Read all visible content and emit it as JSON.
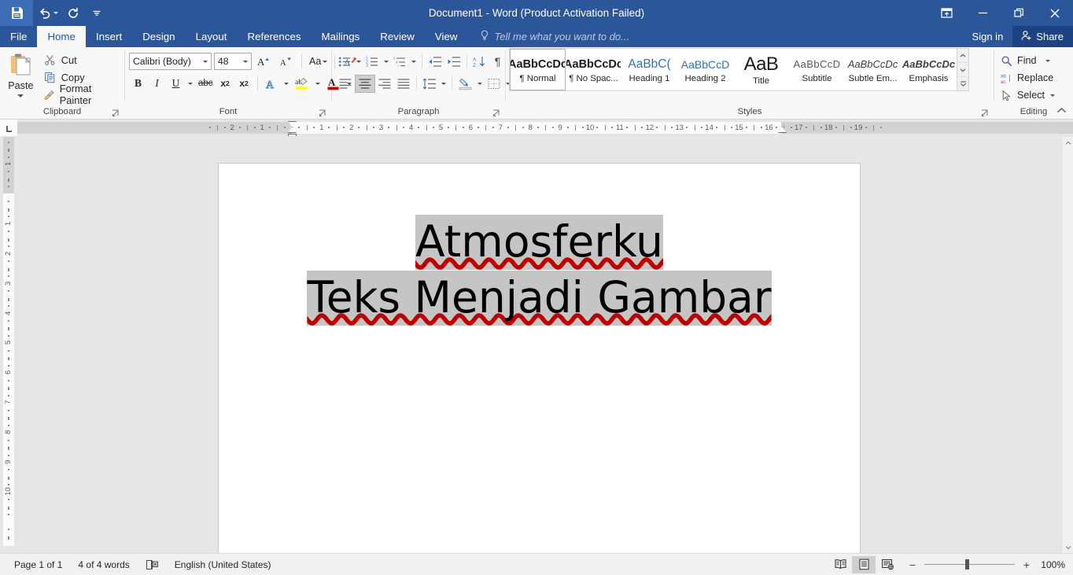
{
  "window": {
    "title": "Document1 - Word (Product Activation Failed)",
    "controls": {
      "ribbon_display_options": "ribbon-display-options",
      "minimize": "minimize",
      "restore": "restore",
      "close": "close"
    }
  },
  "quick_access": {
    "save": "Save",
    "undo": "Undo",
    "redo": "Redo",
    "customize": "Customize Quick Access Toolbar"
  },
  "tabs": [
    {
      "label": "File",
      "active": false
    },
    {
      "label": "Home",
      "active": true
    },
    {
      "label": "Insert",
      "active": false
    },
    {
      "label": "Design",
      "active": false
    },
    {
      "label": "Layout",
      "active": false
    },
    {
      "label": "References",
      "active": false
    },
    {
      "label": "Mailings",
      "active": false
    },
    {
      "label": "Review",
      "active": false
    },
    {
      "label": "View",
      "active": false
    }
  ],
  "tell_me": {
    "placeholder": "Tell me what you want to do..."
  },
  "account": {
    "sign_in": "Sign in",
    "share": "Share"
  },
  "ribbon": {
    "clipboard": {
      "group_label": "Clipboard",
      "paste": "Paste",
      "cut": "Cut",
      "copy": "Copy",
      "format_painter": "Format Painter"
    },
    "font": {
      "group_label": "Font",
      "font_name": "Calibri (Body)",
      "font_size": "48",
      "grow_font": "A",
      "shrink_font": "A",
      "change_case": "Aa",
      "clear_formatting": "Clear All Formatting",
      "bold": "B",
      "italic": "I",
      "underline": "U",
      "strikethrough": "abc",
      "subscript": "x",
      "subscript_sup": "2",
      "superscript": "x",
      "superscript_sup": "2",
      "text_effects": "A",
      "highlight": "ab",
      "font_color": "A"
    },
    "paragraph": {
      "group_label": "Paragraph",
      "bullets": "Bullets",
      "numbering": "Numbering",
      "multilevel": "Multilevel List",
      "decrease_indent": "Decrease Indent",
      "increase_indent": "Increase Indent",
      "sort": "Sort",
      "show_marks": "¶",
      "align_left": "Align Left",
      "align_center": "Center",
      "align_right": "Align Right",
      "justify": "Justify",
      "line_spacing": "Line and Paragraph Spacing",
      "shading": "Shading",
      "borders": "Borders",
      "active_alignment": "Center"
    },
    "styles": {
      "group_label": "Styles",
      "items": [
        {
          "preview": "AaBbCcDc",
          "name": "¶ Normal",
          "selected": true,
          "style": "bold"
        },
        {
          "preview": "AaBbCcDc",
          "name": "¶ No Spac...",
          "selected": false,
          "style": "bold"
        },
        {
          "preview": "AaBbC(",
          "name": "Heading 1",
          "selected": false,
          "style": "blue"
        },
        {
          "preview": "AaBbCcD",
          "name": "Heading 2",
          "selected": false,
          "style": "blue"
        },
        {
          "preview": "AaB",
          "name": "Title",
          "selected": false,
          "style": "title"
        },
        {
          "preview": "AaBbCcD",
          "name": "Subtitle",
          "selected": false,
          "style": "gray"
        },
        {
          "preview": "AaBbCcDc",
          "name": "Subtle Em...",
          "selected": false,
          "style": "ital"
        },
        {
          "preview": "AaBbCcDc",
          "name": "Emphasis",
          "selected": false,
          "style": "bital"
        }
      ],
      "scroll_up": "scroll-up",
      "scroll_down": "scroll-down",
      "more": "more-styles"
    },
    "editing": {
      "group_label": "Editing",
      "find": "Find",
      "replace": "Replace",
      "select": "Select"
    },
    "collapse": "collapse-ribbon"
  },
  "ruler": {
    "corner_label": "L",
    "horizontal_ticks": [
      "2",
      "1",
      "1",
      "2",
      "3",
      "4",
      "5",
      "6",
      "7",
      "8",
      "9",
      "10",
      "11",
      "12",
      "13",
      "14",
      "15",
      "16",
      "17",
      "18",
      "19"
    ],
    "vertical_ticks": [
      "2",
      "1",
      "1",
      "2",
      "3",
      "4",
      "5",
      "6",
      "7",
      "8",
      "9",
      "10"
    ]
  },
  "document": {
    "lines": [
      {
        "text": "Atmosferku",
        "highlighted": true,
        "misspelled": true
      },
      {
        "text": "Teks Menjadi Gambar",
        "highlighted": true,
        "misspelled": true
      }
    ]
  },
  "status_bar": {
    "page": "Page 1 of 1",
    "words": "4 of 4 words",
    "proofing": "proofing-errors",
    "language": "English (United States)",
    "views": [
      {
        "name": "Read Mode",
        "active": false
      },
      {
        "name": "Print Layout",
        "active": true
      },
      {
        "name": "Web Layout",
        "active": false
      }
    ],
    "zoom_out": "−",
    "zoom_in": "+",
    "zoom_level": "100%"
  },
  "colors": {
    "accent": "#2b579a",
    "accent_dark": "#1e4383",
    "ribbon_bg": "#f8f8f8",
    "canvas_bg": "#e6e6e6",
    "selection": "#c5c5c5",
    "spell_error": "#c00000",
    "heading_blue": "#2e74b5"
  }
}
